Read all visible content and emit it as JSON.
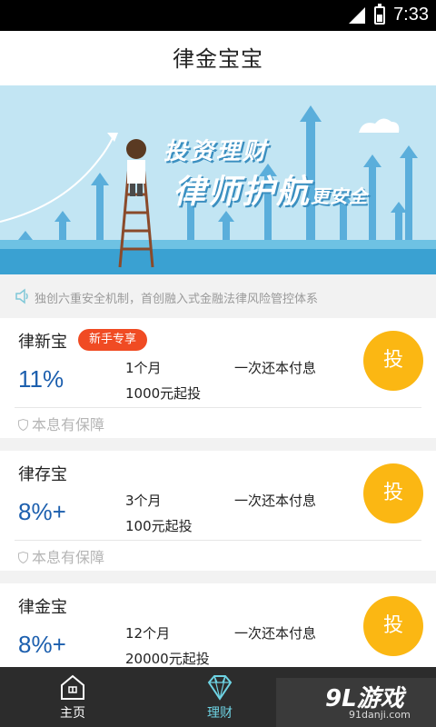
{
  "status_bar": {
    "time": "7:33"
  },
  "header": {
    "title": "律金宝宝"
  },
  "banner": {
    "line1": "投资理财",
    "line2": "律师护航",
    "line2_small": "更安全"
  },
  "notice": {
    "text": "独创六重安全机制，首创融入式金融法律风险管控体系"
  },
  "products": [
    {
      "name": "律新宝",
      "badge": "新手专享",
      "rate": "11%",
      "term": "1个月",
      "min": "1000元起投",
      "repay": "一次还本付息",
      "invest": "投",
      "guarantee": "本息有保障"
    },
    {
      "name": "律存宝",
      "rate": "8%+",
      "term": "3个月",
      "min": "100元起投",
      "repay": "一次还本付息",
      "invest": "投",
      "guarantee": "本息有保障"
    },
    {
      "name": "律金宝",
      "rate": "8%+",
      "term": "12个月",
      "min": "20000元起投",
      "repay": "一次还本付息",
      "invest": "投"
    }
  ],
  "tabs": [
    {
      "label": "主页",
      "icon": "home-icon"
    },
    {
      "label": "理财",
      "icon": "diamond-icon"
    }
  ],
  "watermark": {
    "logo": "9L游戏",
    "url": "91danji.com"
  },
  "colors": {
    "accent": "#fbb713",
    "rate": "#1c5fae",
    "badge": "#f04b23",
    "tab_active": "#6ed3e3"
  }
}
